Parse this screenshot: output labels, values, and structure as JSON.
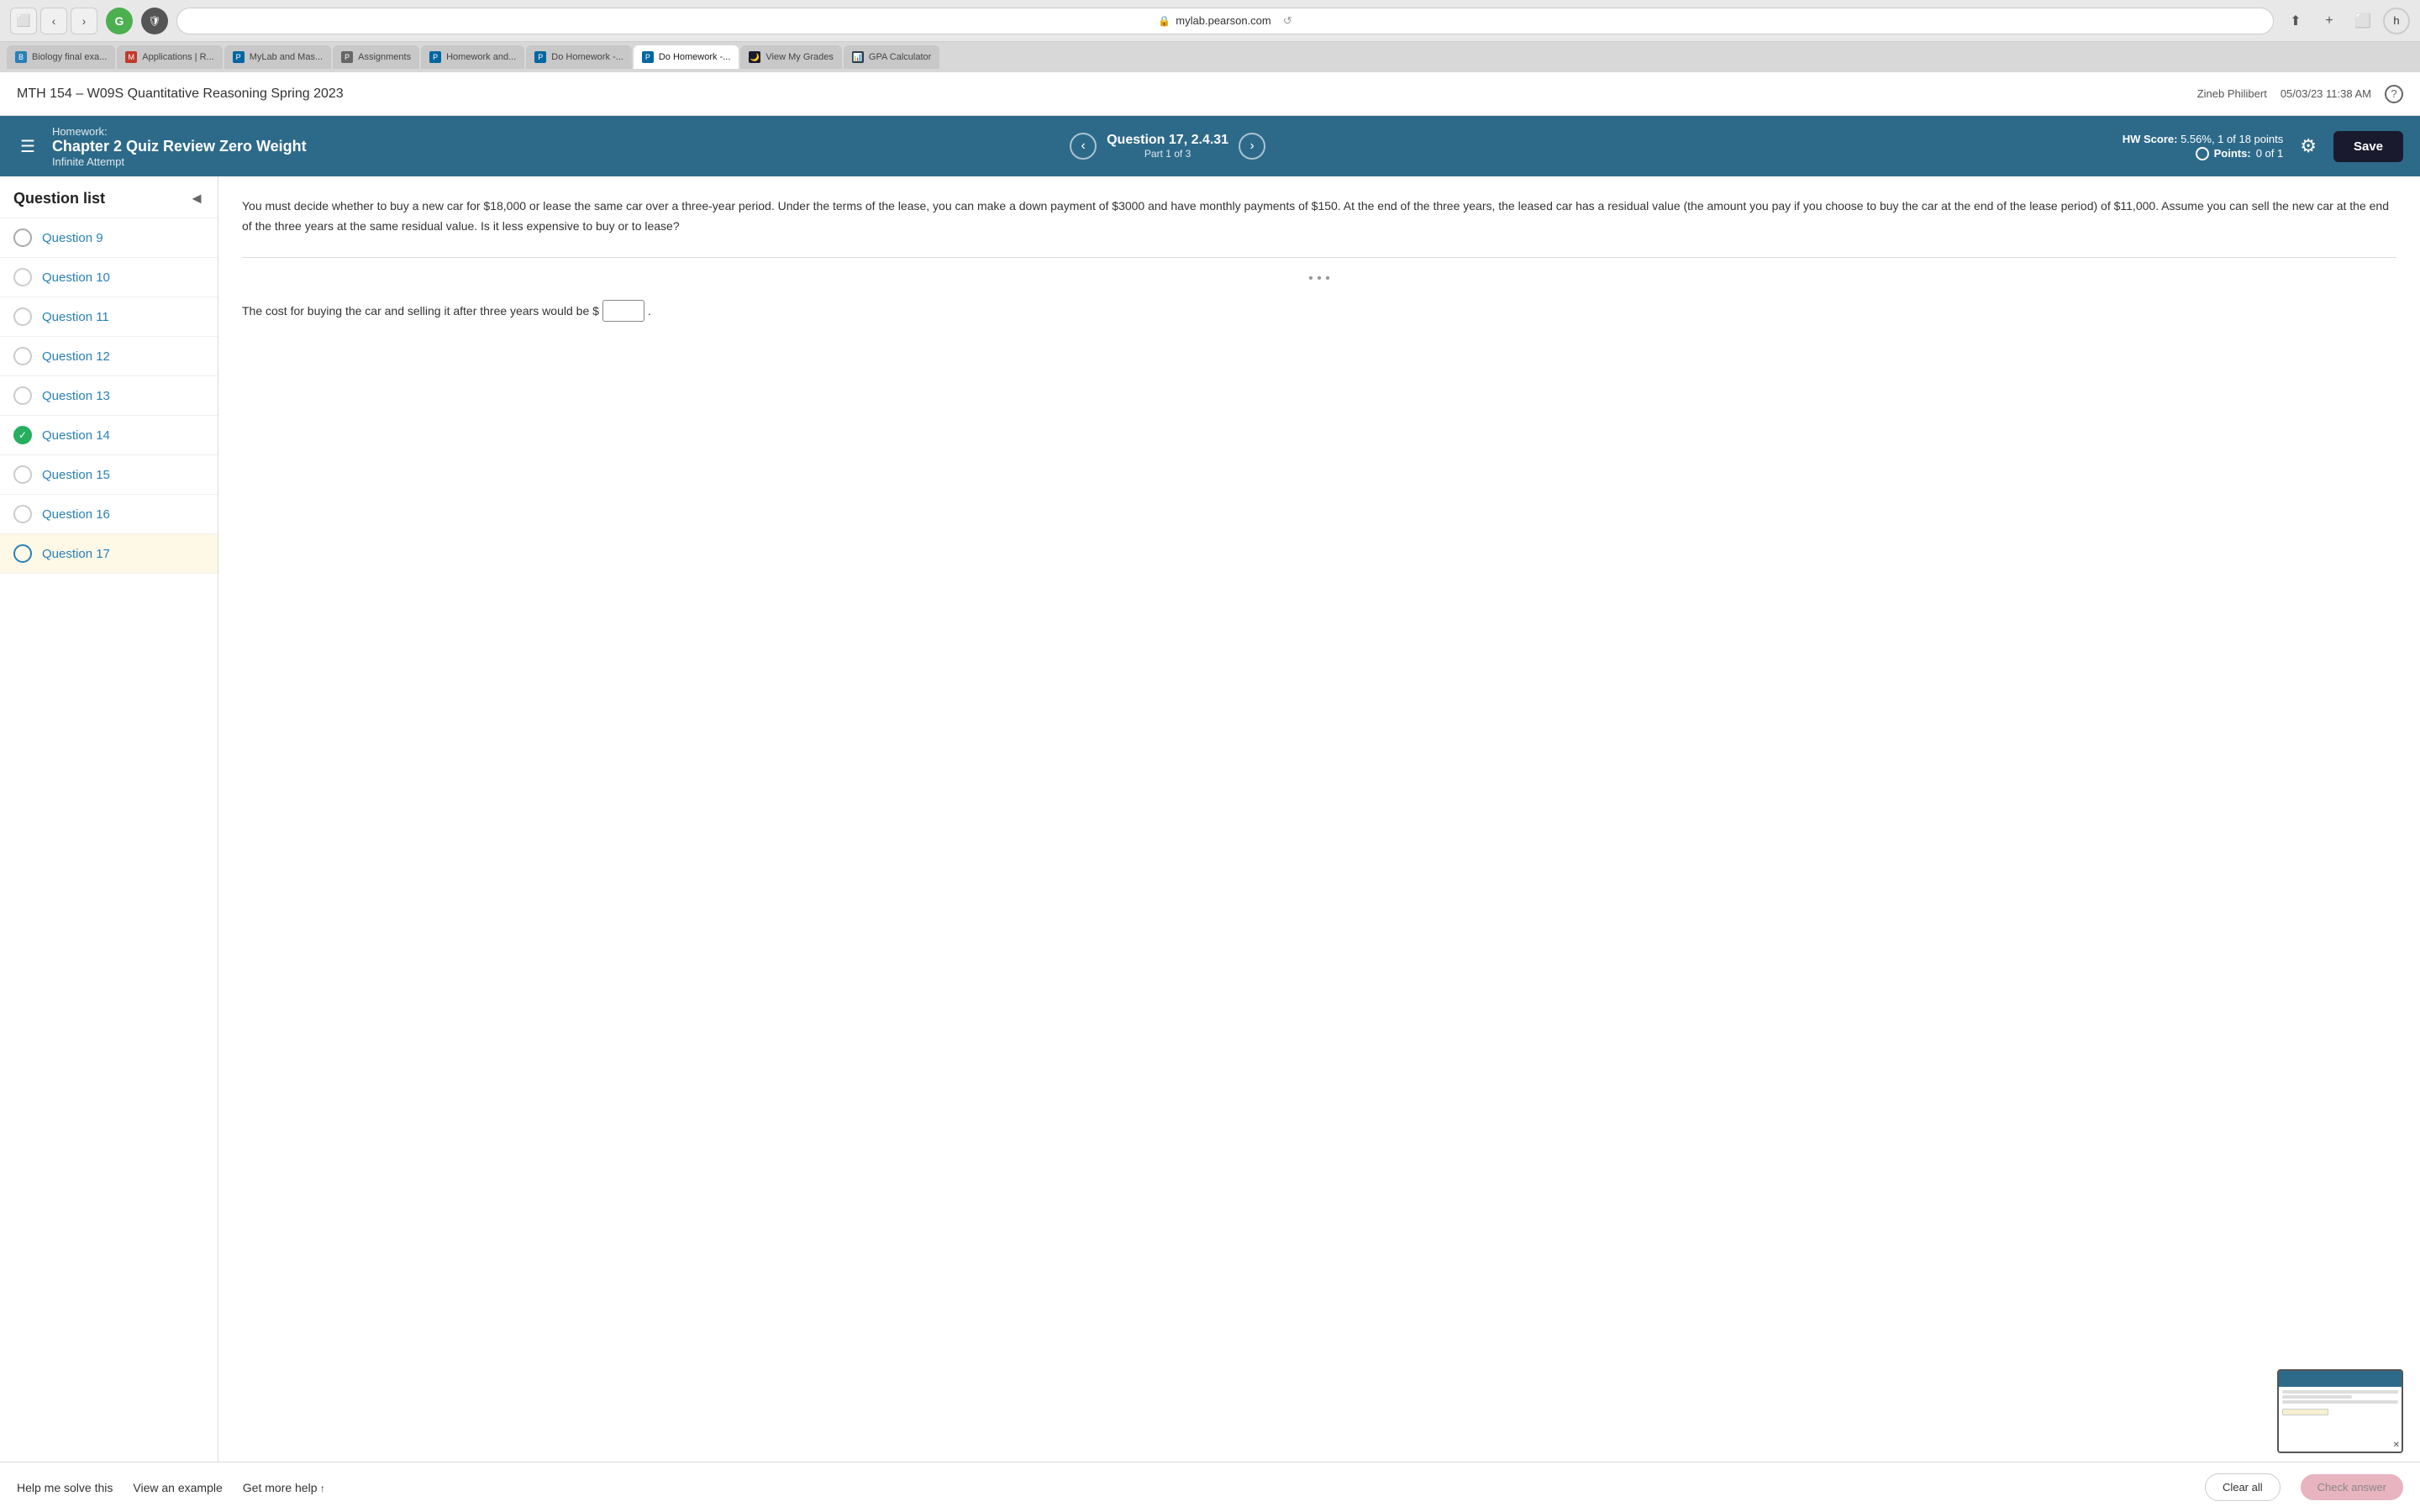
{
  "browser": {
    "url": "mylab.pearson.com",
    "tabs": [
      {
        "id": "bio",
        "label": "Biology final exa...",
        "favicon_color": "#2980b9",
        "favicon_text": "B",
        "active": false
      },
      {
        "id": "applications",
        "label": "Applications | R...",
        "favicon_color": "#c0392b",
        "favicon_text": "M",
        "active": false
      },
      {
        "id": "mylab",
        "label": "MyLab and Mas...",
        "favicon_color": "#3498db",
        "favicon_text": "P",
        "active": false
      },
      {
        "id": "assignments",
        "label": "Assignments",
        "favicon_color": "#666",
        "favicon_text": "P",
        "active": false
      },
      {
        "id": "homework1",
        "label": "Homework and...",
        "favicon_color": "#0066a1",
        "favicon_text": "P",
        "active": false
      },
      {
        "id": "dohomework1",
        "label": "Do Homework -...",
        "favicon_color": "#0066a1",
        "favicon_text": "P",
        "active": false
      },
      {
        "id": "dohomework2",
        "label": "Do Homework -...",
        "favicon_color": "#0066a1",
        "favicon_text": "P",
        "active": true
      },
      {
        "id": "grades",
        "label": "View My Grades",
        "favicon_color": "#555",
        "favicon_text": "🌙",
        "active": false
      },
      {
        "id": "gpa",
        "label": "GPA Calculator",
        "favicon_color": "#2c3e50",
        "favicon_text": "📊",
        "active": false
      }
    ]
  },
  "page_header": {
    "title": "MTH 154 – W09S Quantitative Reasoning Spring 2023",
    "user": "Zineb Philibert",
    "datetime": "05/03/23  11:38 AM"
  },
  "hw_header": {
    "homework_label": "Homework:",
    "title": "Chapter 2 Quiz Review Zero Weight",
    "subtitle": "Infinite Attempt",
    "question_num": "Question 17, 2.4.31",
    "question_part": "Part 1 of 3",
    "hw_score_label": "HW Score:",
    "hw_score_value": "5.56%, 1 of 18 points",
    "points_label": "Points:",
    "points_value": "0 of 1",
    "save_label": "Save"
  },
  "sidebar": {
    "title": "Question list",
    "questions": [
      {
        "id": 9,
        "label": "Question 9",
        "status": "partial"
      },
      {
        "id": 10,
        "label": "Question 10",
        "status": "none"
      },
      {
        "id": 11,
        "label": "Question 11",
        "status": "none"
      },
      {
        "id": 12,
        "label": "Question 12",
        "status": "none"
      },
      {
        "id": 13,
        "label": "Question 13",
        "status": "none"
      },
      {
        "id": 14,
        "label": "Question 14",
        "status": "completed"
      },
      {
        "id": 15,
        "label": "Question 15",
        "status": "none"
      },
      {
        "id": 16,
        "label": "Question 16",
        "status": "none"
      },
      {
        "id": 17,
        "label": "Question 17",
        "status": "active"
      }
    ]
  },
  "question": {
    "text": "You must decide whether to buy a new car for $18,000 or lease the same car over a three-year period. Under the terms of the lease, you can make a down payment of $3000 and have monthly payments of $150. At the end of the three years, the leased car has a residual value (the amount you pay if you choose to buy the car at the end of the lease period) of $11,000. Assume you can sell the new car at the end of the three years at the same residual value. Is it less expensive to buy or to lease?",
    "answer_prefix": "The cost for buying the car and selling it after three years would be $",
    "answer_suffix": ".",
    "input_placeholder": ""
  },
  "footer": {
    "help_me_solve": "Help me solve this",
    "view_example": "View an example",
    "get_more_help": "Get more help",
    "clear_all": "Clear all",
    "check_answer": "Check answer"
  },
  "icons": {
    "menu": "☰",
    "prev_arrow": "‹",
    "next_arrow": "›",
    "gear": "⚙",
    "collapse": "◄",
    "check": "✓",
    "lock": "🔒",
    "help": "?"
  }
}
